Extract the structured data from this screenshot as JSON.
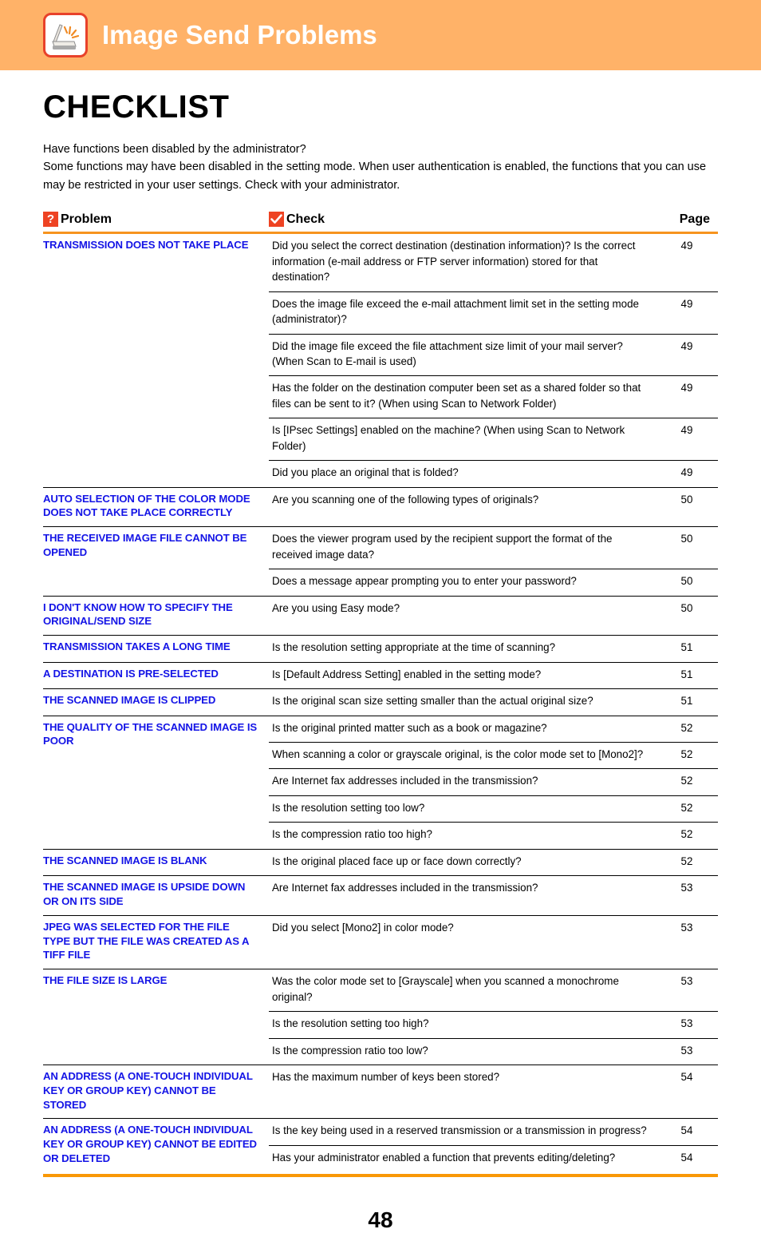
{
  "header": {
    "title": "Image Send Problems",
    "icon": "scanner-icon",
    "bar_color": "#ffb268",
    "icon_border_color": "#e8412a"
  },
  "document": {
    "title": "CHECKLIST",
    "intro_line_1": "Have functions been disabled by the administrator?",
    "intro_line_2": "Some functions may have been disabled in the setting mode. When user authentication is enabled, the functions that you can use may be restricted in your user settings. Check with your administrator.",
    "page_number": "48",
    "accent_color": "#f7941e",
    "problem_text_color": "#1414e6"
  },
  "table": {
    "headers": {
      "problem": "Problem",
      "check": "Check",
      "page": "Page",
      "problem_icon": "question-mark-icon",
      "check_icon": "checkmark-icon"
    },
    "groups": [
      {
        "problem": "TRANSMISSION DOES NOT TAKE PLACE",
        "rows": [
          {
            "check": "Did you select the correct destination (destination information)? Is the correct information (e-mail address or FTP server information) stored for that destination?",
            "page": "49"
          },
          {
            "check": "Does the image file exceed the e-mail attachment limit set in the setting mode (administrator)?",
            "page": "49"
          },
          {
            "check": "Did the image file exceed the file attachment size limit of your mail server? (When Scan to E-mail is used)",
            "page": "49"
          },
          {
            "check": "Has the folder on the destination computer been set as a shared folder so that files can be sent to it? (When using Scan to Network Folder)",
            "page": "49"
          },
          {
            "check": "Is [IPsec Settings] enabled on the machine? (When using Scan to Network Folder)",
            "page": "49"
          },
          {
            "check": "Did you place an original that is folded?",
            "page": "49"
          }
        ]
      },
      {
        "problem": "AUTO SELECTION OF THE COLOR MODE DOES NOT TAKE PLACE CORRECTLY",
        "rows": [
          {
            "check": "Are you scanning one of the following types of originals?",
            "page": "50"
          }
        ]
      },
      {
        "problem": "THE RECEIVED IMAGE FILE CANNOT BE OPENED",
        "rows": [
          {
            "check": "Does the viewer program used by the recipient support the format of the received image data?",
            "page": "50"
          },
          {
            "check": "Does a message appear prompting you to enter your password?",
            "page": "50"
          }
        ]
      },
      {
        "problem": "I DON'T KNOW HOW TO SPECIFY THE ORIGINAL/SEND SIZE",
        "rows": [
          {
            "check": "Are you using Easy mode?",
            "page": "50"
          }
        ]
      },
      {
        "problem": "TRANSMISSION TAKES A LONG TIME",
        "rows": [
          {
            "check": "Is the resolution setting appropriate at the time of scanning?",
            "page": "51"
          }
        ]
      },
      {
        "problem": "A DESTINATION IS PRE-SELECTED",
        "rows": [
          {
            "check": "Is [Default Address Setting] enabled in the setting mode?",
            "page": "51"
          }
        ]
      },
      {
        "problem": "THE SCANNED IMAGE IS CLIPPED",
        "rows": [
          {
            "check": "Is the original scan size setting smaller than the actual original size?",
            "page": "51"
          }
        ]
      },
      {
        "problem": "THE QUALITY OF THE SCANNED IMAGE IS POOR",
        "rows": [
          {
            "check": "Is the original printed matter such as a book or magazine?",
            "page": "52"
          },
          {
            "check": "When scanning a color or grayscale original, is the color mode set to [Mono2]?",
            "page": "52"
          },
          {
            "check": "Are Internet fax addresses included in the transmission?",
            "page": "52"
          },
          {
            "check": "Is the resolution setting too low?",
            "page": "52"
          },
          {
            "check": "Is the compression ratio too high?",
            "page": "52"
          }
        ]
      },
      {
        "problem": "THE SCANNED IMAGE IS BLANK",
        "rows": [
          {
            "check": "Is the original placed face up or face down correctly?",
            "page": "52"
          }
        ]
      },
      {
        "problem": "THE SCANNED IMAGE IS UPSIDE DOWN OR ON ITS SIDE",
        "rows": [
          {
            "check": "Are Internet fax addresses included in the transmission?",
            "page": "53"
          }
        ]
      },
      {
        "problem": "JPEG WAS SELECTED FOR THE FILE TYPE BUT THE FILE WAS CREATED AS A TIFF FILE",
        "rows": [
          {
            "check": "Did you select [Mono2] in color mode?",
            "page": "53"
          }
        ]
      },
      {
        "problem": "THE FILE SIZE IS LARGE",
        "rows": [
          {
            "check": "Was the color mode set to [Grayscale] when you scanned a monochrome original?",
            "page": "53"
          },
          {
            "check": "Is the resolution setting too high?",
            "page": "53"
          },
          {
            "check": "Is the compression ratio too low?",
            "page": "53"
          }
        ]
      },
      {
        "problem": "AN ADDRESS (A ONE-TOUCH INDIVIDUAL KEY OR GROUP KEY) CANNOT BE STORED",
        "rows": [
          {
            "check": "Has the maximum number of keys been stored?",
            "page": "54"
          }
        ]
      },
      {
        "problem": "AN ADDRESS (A ONE-TOUCH INDIVIDUAL KEY OR GROUP KEY) CANNOT BE EDITED OR DELETED",
        "rows": [
          {
            "check": "Is the key being used in a reserved transmission or a transmission in progress?",
            "page": "54"
          },
          {
            "check": "Has your administrator enabled a function that prevents editing/deleting?",
            "page": "54"
          }
        ]
      }
    ]
  }
}
